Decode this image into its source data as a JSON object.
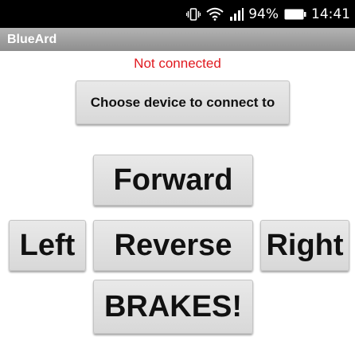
{
  "status_bar": {
    "battery": "94%",
    "time": "14:41",
    "icons": [
      "vibrate-icon",
      "wifi-icon",
      "signal-icon",
      "battery-icon"
    ]
  },
  "app": {
    "title": "BlueArd"
  },
  "connection": {
    "status_text": "Not connected",
    "status_color": "#e0191f"
  },
  "controls": {
    "choose_device_label": "Choose device to connect to",
    "forward_label": "Forward",
    "left_label": "Left",
    "reverse_label": "Reverse",
    "right_label": "Right",
    "brakes_label": "BRAKES!"
  }
}
